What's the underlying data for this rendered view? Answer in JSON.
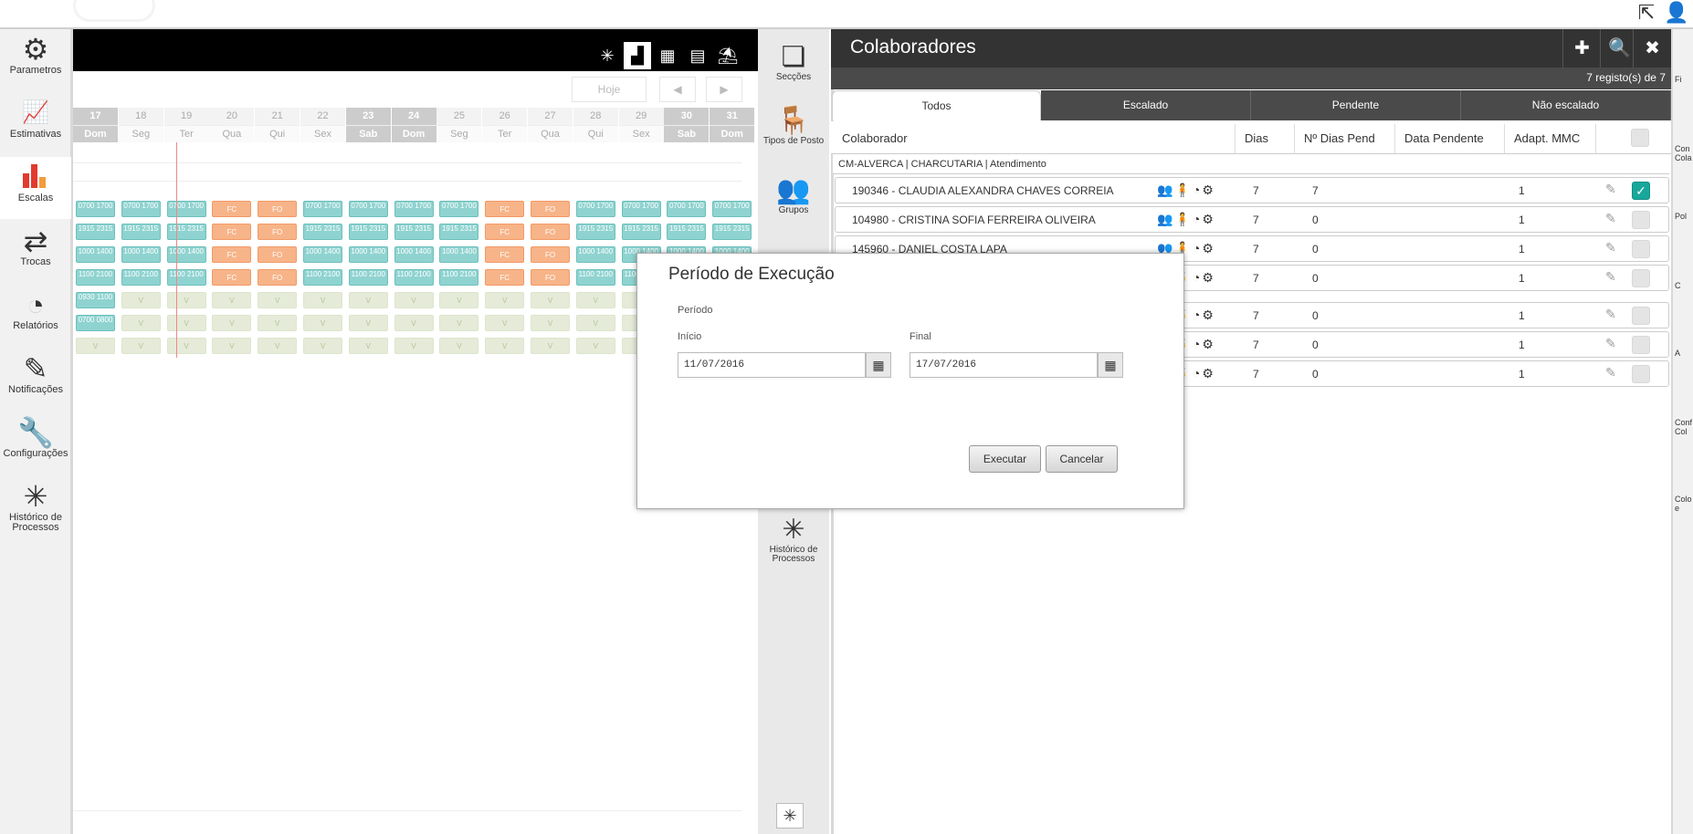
{
  "sidebar": {
    "items": [
      {
        "label": "Parametros",
        "icon": "gear-icon"
      },
      {
        "label": "Estimativas",
        "icon": "line-chart-icon"
      },
      {
        "label": "Escalas",
        "icon": "bar-chart-icon"
      },
      {
        "label": "Trocas",
        "icon": "swap-icon"
      },
      {
        "label": "Relatórios",
        "icon": "pie-chart-icon"
      },
      {
        "label": "Notificações",
        "icon": "note-icon"
      },
      {
        "label": "Configurações",
        "icon": "wrench-icon"
      },
      {
        "label": "Histórico de Processos",
        "icon": "process-history-icon"
      }
    ]
  },
  "scheduler": {
    "today_button": "Hoje",
    "prev": "◀",
    "next": "▶",
    "days": [
      {
        "num": "17",
        "dow": "Dom",
        "weekend": true
      },
      {
        "num": "18",
        "dow": "Seg"
      },
      {
        "num": "19",
        "dow": "Ter"
      },
      {
        "num": "20",
        "dow": "Qua"
      },
      {
        "num": "21",
        "dow": "Qui"
      },
      {
        "num": "22",
        "dow": "Sex"
      },
      {
        "num": "23",
        "dow": "Sab",
        "weekend": true
      },
      {
        "num": "24",
        "dow": "Dom",
        "weekend": true
      },
      {
        "num": "25",
        "dow": "Seg"
      },
      {
        "num": "26",
        "dow": "Ter"
      },
      {
        "num": "27",
        "dow": "Qua"
      },
      {
        "num": "28",
        "dow": "Qui"
      },
      {
        "num": "29",
        "dow": "Sex"
      },
      {
        "num": "30",
        "dow": "Sab",
        "weekend": true
      },
      {
        "num": "31",
        "dow": "Dom",
        "weekend": true
      }
    ],
    "rows": [
      [
        "0700 1700",
        "0700 1700",
        "0700 1700",
        "FC",
        "FO",
        "0700 1700",
        "0700 1700",
        "0700 1700",
        "0700 1700",
        "FC",
        "FO",
        "0700 1700",
        "0700 1700",
        "0700 1700",
        "0700 1700"
      ],
      [
        "1915 2315",
        "1915 2315",
        "1915 2315",
        "FC",
        "FO",
        "1915 2315",
        "1915 2315",
        "1915 2315",
        "1915 2315",
        "FC",
        "FO",
        "1915 2315",
        "1915 2315",
        "1915 2315",
        "1915 2315"
      ],
      [
        "1000 1400",
        "1000 1400",
        "1000 1400",
        "FC",
        "FO",
        "1000 1400",
        "1000 1400",
        "1000 1400",
        "1000 1400",
        "FC",
        "FO",
        "1000 1400",
        "1000 1400",
        "1000 1400",
        "1000 1400"
      ],
      [
        "1100 2100",
        "1100 2100",
        "1100 2100",
        "FC",
        "FO",
        "1100 2100",
        "1100 2100",
        "1100 2100",
        "1100 2100",
        "FC",
        "FO",
        "1100 2100",
        "1100 2100",
        "1100 2100",
        "1100 2100"
      ],
      [
        "0930 1100",
        "V",
        "V",
        "V",
        "V",
        "V",
        "V",
        "V",
        "V",
        "V",
        "V",
        "V",
        "V",
        "V",
        "V"
      ],
      [
        "0700 0800",
        "V",
        "V",
        "V",
        "V",
        "V",
        "V",
        "V",
        "V",
        "V",
        "V",
        "V",
        "V",
        "V",
        "V"
      ],
      [
        "V",
        "V",
        "V",
        "V",
        "V",
        "V",
        "V",
        "V",
        "V",
        "V",
        "V",
        "V",
        "V",
        "V",
        "V"
      ]
    ]
  },
  "midnav": {
    "items": [
      {
        "label": "Secções",
        "icon": "sections-icon"
      },
      {
        "label": "Tipos de Posto",
        "icon": "chair-icon"
      },
      {
        "label": "Grupos",
        "icon": "group-icon"
      },
      {
        "label": "Histórico de Processos",
        "icon": "process-history-icon"
      }
    ]
  },
  "panel": {
    "title": "Colaboradores",
    "count": "7  registo(s) de  7",
    "tabs": [
      "Todos",
      "Escalado",
      "Pendente",
      "Não escalado"
    ],
    "columns": [
      "Colaborador",
      "Dias",
      "Nº Dias Pend",
      "Data Pendente",
      "Adapt. MMC (1)"
    ],
    "group": "CM-ALVERCA | CHARCUTARIA | Atendimento",
    "rows": [
      {
        "name": "190346 - CLAUDIA ALEXANDRA CHAVES CORREIA",
        "dias": "7",
        "pend": "7",
        "mmc": "1",
        "checked": true
      },
      {
        "name": "104980 - CRISTINA SOFIA FERREIRA OLIVEIRA",
        "dias": "7",
        "pend": "0",
        "mmc": "1"
      },
      {
        "name": "145960 - DANIEL COSTA LAPA",
        "dias": "7",
        "pend": "0",
        "mmc": "1"
      },
      {
        "name": "",
        "dias": "7",
        "pend": "0",
        "mmc": "1"
      },
      {
        "name": "",
        "dias": "7",
        "pend": "0",
        "mmc": "1"
      },
      {
        "name": "",
        "dias": "7",
        "pend": "0",
        "mmc": "1"
      },
      {
        "name": "",
        "dias": "7",
        "pend": "0",
        "mmc": "1"
      }
    ]
  },
  "right_labels": [
    "Fi",
    "Con Cola",
    "Pol",
    "C",
    "A",
    "Conf Col",
    "Colo e"
  ],
  "modal": {
    "title": "Período de Execução",
    "section": "Período",
    "start_label": "Início",
    "start_value": "11/07/2016",
    "end_label": "Final",
    "end_value": "17/07/2016",
    "execute": "Executar",
    "cancel": "Cancelar"
  },
  "colors": {
    "teal": "#8fd3d0",
    "orange": "#f7b489",
    "vacation": "#e5ebd8",
    "dark": "#333333",
    "check": "#19a79c"
  }
}
